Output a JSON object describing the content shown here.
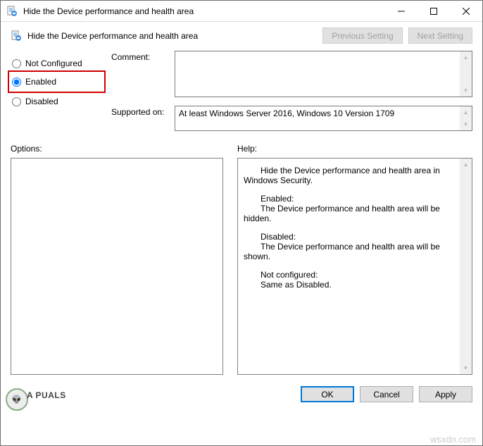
{
  "window": {
    "title": "Hide the Device performance and health area"
  },
  "header": {
    "label": "Hide the Device performance and health area",
    "prev": "Previous Setting",
    "next": "Next Setting"
  },
  "radio": {
    "not_configured": "Not Configured",
    "enabled": "Enabled",
    "disabled": "Disabled"
  },
  "fields": {
    "comment_label": "Comment:",
    "comment_value": "",
    "supported_label": "Supported on:",
    "supported_value": "At least Windows Server 2016, Windows 10 Version 1709"
  },
  "panes": {
    "options_label": "Options:",
    "help_label": "Help:",
    "help_p1": "Hide the Device performance and health area in Windows Security.",
    "help_p2a": "Enabled:",
    "help_p2b": "The Device performance and health area will be hidden.",
    "help_p3a": "Disabled:",
    "help_p3b": "The Device performance and health area will be shown.",
    "help_p4a": "Not configured:",
    "help_p4b": "Same as Disabled."
  },
  "footer": {
    "ok": "OK",
    "cancel": "Cancel",
    "apply": "Apply"
  },
  "watermark": {
    "a": "A  PUALS",
    "b": "wsxdn.com"
  }
}
